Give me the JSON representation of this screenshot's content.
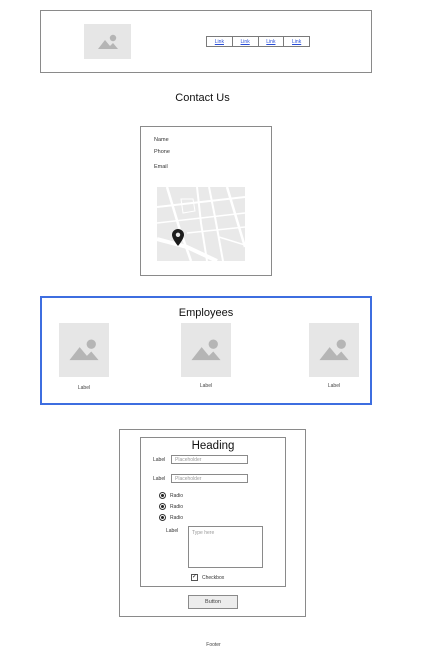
{
  "header": {
    "logo_icon": "image-placeholder-icon",
    "nav_links": [
      "Link",
      "Link",
      "Link",
      "Link"
    ]
  },
  "contact": {
    "title": "Contact Us",
    "fields": [
      "Name",
      "Phone",
      "Email"
    ],
    "map_icon": "map-placeholder",
    "pin_icon": "map-pin-icon"
  },
  "employees": {
    "title": "Employees",
    "items": [
      {
        "label": "Label",
        "icon": "image-placeholder-icon"
      },
      {
        "label": "Label",
        "icon": "image-placeholder-icon"
      },
      {
        "label": "Label",
        "icon": "image-placeholder-icon"
      }
    ],
    "accent_color": "#3e6ee0"
  },
  "form": {
    "heading": "Heading",
    "inputs": [
      {
        "label": "Label",
        "placeholder": "Placeholder"
      },
      {
        "label": "Label",
        "placeholder": "Placeholder"
      }
    ],
    "radios": [
      {
        "label": "Radio",
        "checked": true
      },
      {
        "label": "Radio",
        "checked": true
      },
      {
        "label": "Radio",
        "checked": true
      }
    ],
    "textarea": {
      "label": "Label",
      "placeholder": "Type here"
    },
    "checkbox": {
      "label": "Checkbox",
      "checked": true
    },
    "button_label": "Button"
  },
  "footer": {
    "text": "Footer"
  }
}
